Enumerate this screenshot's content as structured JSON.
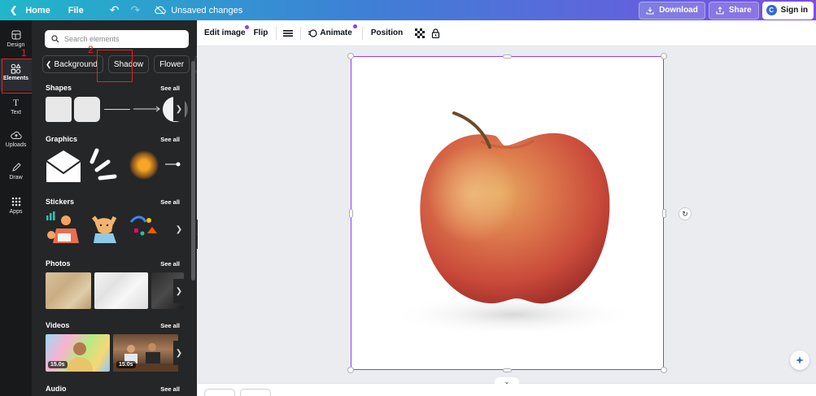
{
  "topbar": {
    "home_label": "Home",
    "file_label": "File",
    "status_text": "Unsaved changes",
    "download_label": "Download",
    "share_label": "Share",
    "signin_label": "Sign in"
  },
  "rail": {
    "items": [
      {
        "label": "Design"
      },
      {
        "label": "Elements"
      },
      {
        "label": "Text"
      },
      {
        "label": "Uploads"
      },
      {
        "label": "Draw"
      },
      {
        "label": "Apps"
      }
    ]
  },
  "annotations": {
    "marker_1": "1",
    "marker_2": "2"
  },
  "panel": {
    "search_placeholder": "Search elements",
    "chips": [
      "Background",
      "Shadow",
      "Flower"
    ],
    "sections": [
      {
        "title": "Shapes",
        "see_all": "See all"
      },
      {
        "title": "Graphics",
        "see_all": "See all"
      },
      {
        "title": "Stickers",
        "see_all": "See all"
      },
      {
        "title": "Photos",
        "see_all": "See all"
      },
      {
        "title": "Videos",
        "see_all": "See all"
      },
      {
        "title": "Audio",
        "see_all": "See all"
      }
    ],
    "video_durations": [
      "15.0s",
      "15.0s"
    ]
  },
  "context_toolbar": {
    "edit_image_label": "Edit image",
    "flip_label": "Flip",
    "animate_label": "Animate",
    "position_label": "Position"
  },
  "colors": {
    "accent": "#8b3dff",
    "annotation_red": "#e02424"
  }
}
